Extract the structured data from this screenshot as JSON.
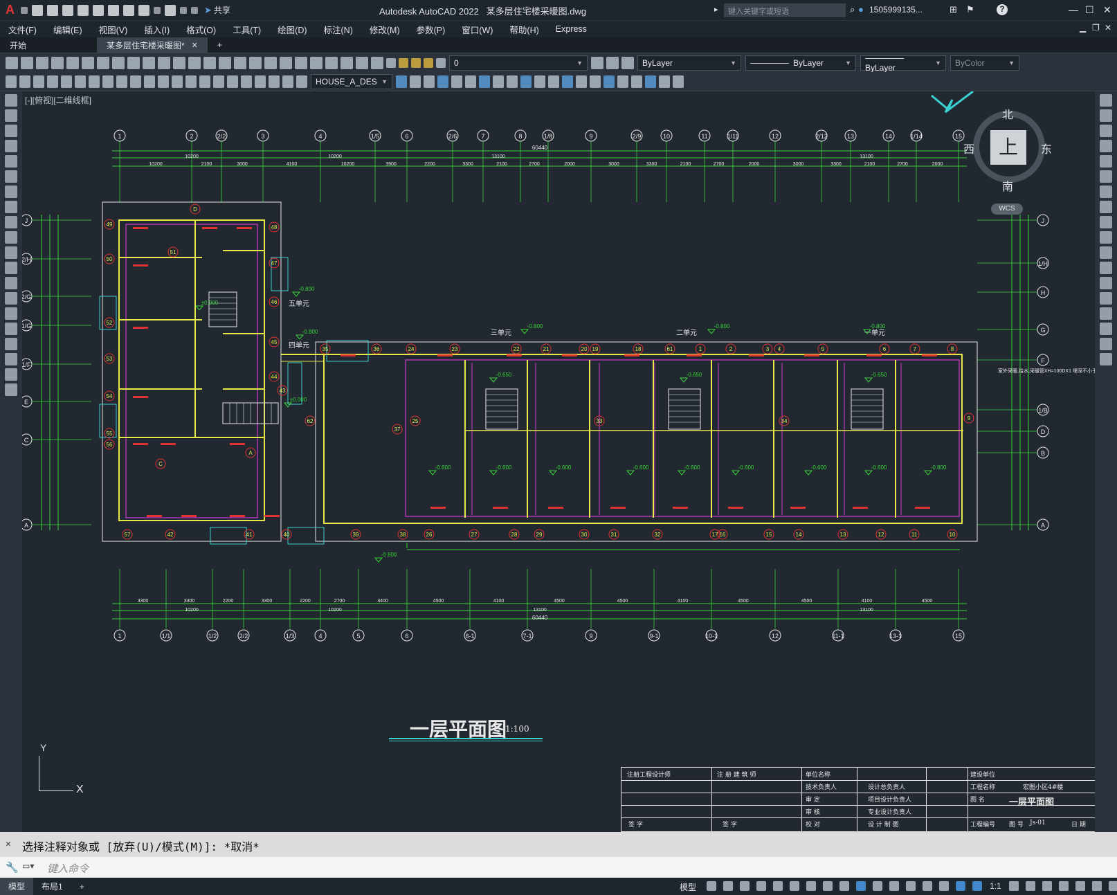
{
  "app": {
    "logo": "A",
    "title": "Autodesk AutoCAD 2022",
    "file": "某多层住宅楼采暖图.dwg",
    "share": "共享"
  },
  "search": {
    "placeholder": "键入关键字或短语"
  },
  "user": {
    "name": "1505999135...",
    "help": "?"
  },
  "menu": [
    "文件(F)",
    "编辑(E)",
    "视图(V)",
    "插入(I)",
    "格式(O)",
    "工具(T)",
    "绘图(D)",
    "标注(N)",
    "修改(M)",
    "参数(P)",
    "窗口(W)",
    "帮助(H)",
    "Express"
  ],
  "tabs": {
    "start": "开始",
    "doc": "某多层住宅楼采暖图*",
    "add": "+"
  },
  "layers": {
    "layer": "0",
    "color": "ByLayer",
    "linetype": "ByLayer",
    "lineweight": "ByLayer",
    "plotstyle": "ByColor",
    "textstyle": "HOUSE_A_DES"
  },
  "viewport": {
    "label": "[-][俯视][二维线框]"
  },
  "viewcube": {
    "north": "北",
    "south": "南",
    "east": "东",
    "west": "西",
    "top": "上",
    "wcs": "WCS"
  },
  "drawing": {
    "title": "一层平面图",
    "scale": "1:100",
    "total": "60440",
    "top_axes": [
      "1",
      "2",
      "2/2",
      "3",
      "4",
      "1/5",
      "6",
      "2/6",
      "7",
      "8",
      "1/8",
      "9",
      "2/9",
      "10",
      "11",
      "1/11",
      "12",
      "2/12",
      "13",
      "14",
      "1/14",
      "15"
    ],
    "bottom_axes": [
      "1",
      "1/1",
      "1/2",
      "2/2",
      "1/3",
      "4",
      "5",
      "6",
      "6-1",
      "7-1",
      "9",
      "9-1",
      "10-1",
      "12",
      "11-1",
      "13-1",
      "15"
    ],
    "left_axes": [
      "J",
      "2/H",
      "2/G",
      "1/G",
      "1/F",
      "E",
      "C",
      "A"
    ],
    "right_axes": [
      "J",
      "1/H",
      "H",
      "G",
      "F",
      "1/B",
      "D",
      "B",
      "A"
    ],
    "top_dims": [
      "10200",
      "2100",
      "3000",
      "4100",
      "10200",
      "3900",
      "2200",
      "3300",
      "2100",
      "2700",
      "2000",
      "3000",
      "3300",
      "2100",
      "2700",
      "2000",
      "3000",
      "3300",
      "2100",
      "2700",
      "2000",
      "3000",
      "13100",
      "13100"
    ],
    "bottom_dims": [
      "3300",
      "3300",
      "2200",
      "3300",
      "2200",
      "2700",
      "3400",
      "4500",
      "4100",
      "4500",
      "4500",
      "4100",
      "4500",
      "4500",
      "4100",
      "4500",
      "10200",
      "13100",
      "13100"
    ],
    "units": [
      "五单元",
      "四单元",
      "三单元",
      "二单元",
      "一单元"
    ],
    "levels": [
      "-0.800",
      "-0.800",
      "-0.800",
      "-0.800",
      "-0.800",
      "±0.000",
      "±0.000",
      "-0.650",
      "-0.650",
      "-0.650",
      "-0.600",
      "-0.600",
      "-0.600",
      "-0.600",
      "-0.600",
      "-0.600",
      "-0.600",
      "-0.600"
    ],
    "note": "室外采暖,给水,采暖管XH=100DX1 埋深不小于-2.1m"
  },
  "titleblock": {
    "r1": [
      "注册工程设计师",
      "注 册 建 筑 师",
      "单位名称",
      "建设单位"
    ],
    "r2": [
      "技术负责人",
      "设计总负责人",
      "工程名称",
      "宏图小区4#楼"
    ],
    "r3": [
      "审 定",
      "项目设计负责人",
      "图 名",
      "一层平面图"
    ],
    "r4": [
      "审 核",
      "专业设计负责人"
    ],
    "r5": [
      "签 字",
      "签 字",
      "校 对",
      "设 计 制 图",
      "工程编号",
      "图 号",
      "Js-01",
      "日 期"
    ]
  },
  "ucs": {
    "y": "Y",
    "x": "X"
  },
  "command": {
    "history": "选择注释对象或 [放弃(U)/模式(M)]: *取消*",
    "placeholder": "键入命令"
  },
  "status": {
    "model_tab": "模型",
    "layout_tab": "布局1",
    "add": "+",
    "model": "模型",
    "scale": "1:1"
  },
  "colors": {
    "bg": "#212830",
    "wall": "#e8e84a",
    "dim": "#3ad23a",
    "pipe": "#d03ad0",
    "cyan": "#3ad0d0",
    "red": "#e03232",
    "white": "#e8e8e8"
  }
}
